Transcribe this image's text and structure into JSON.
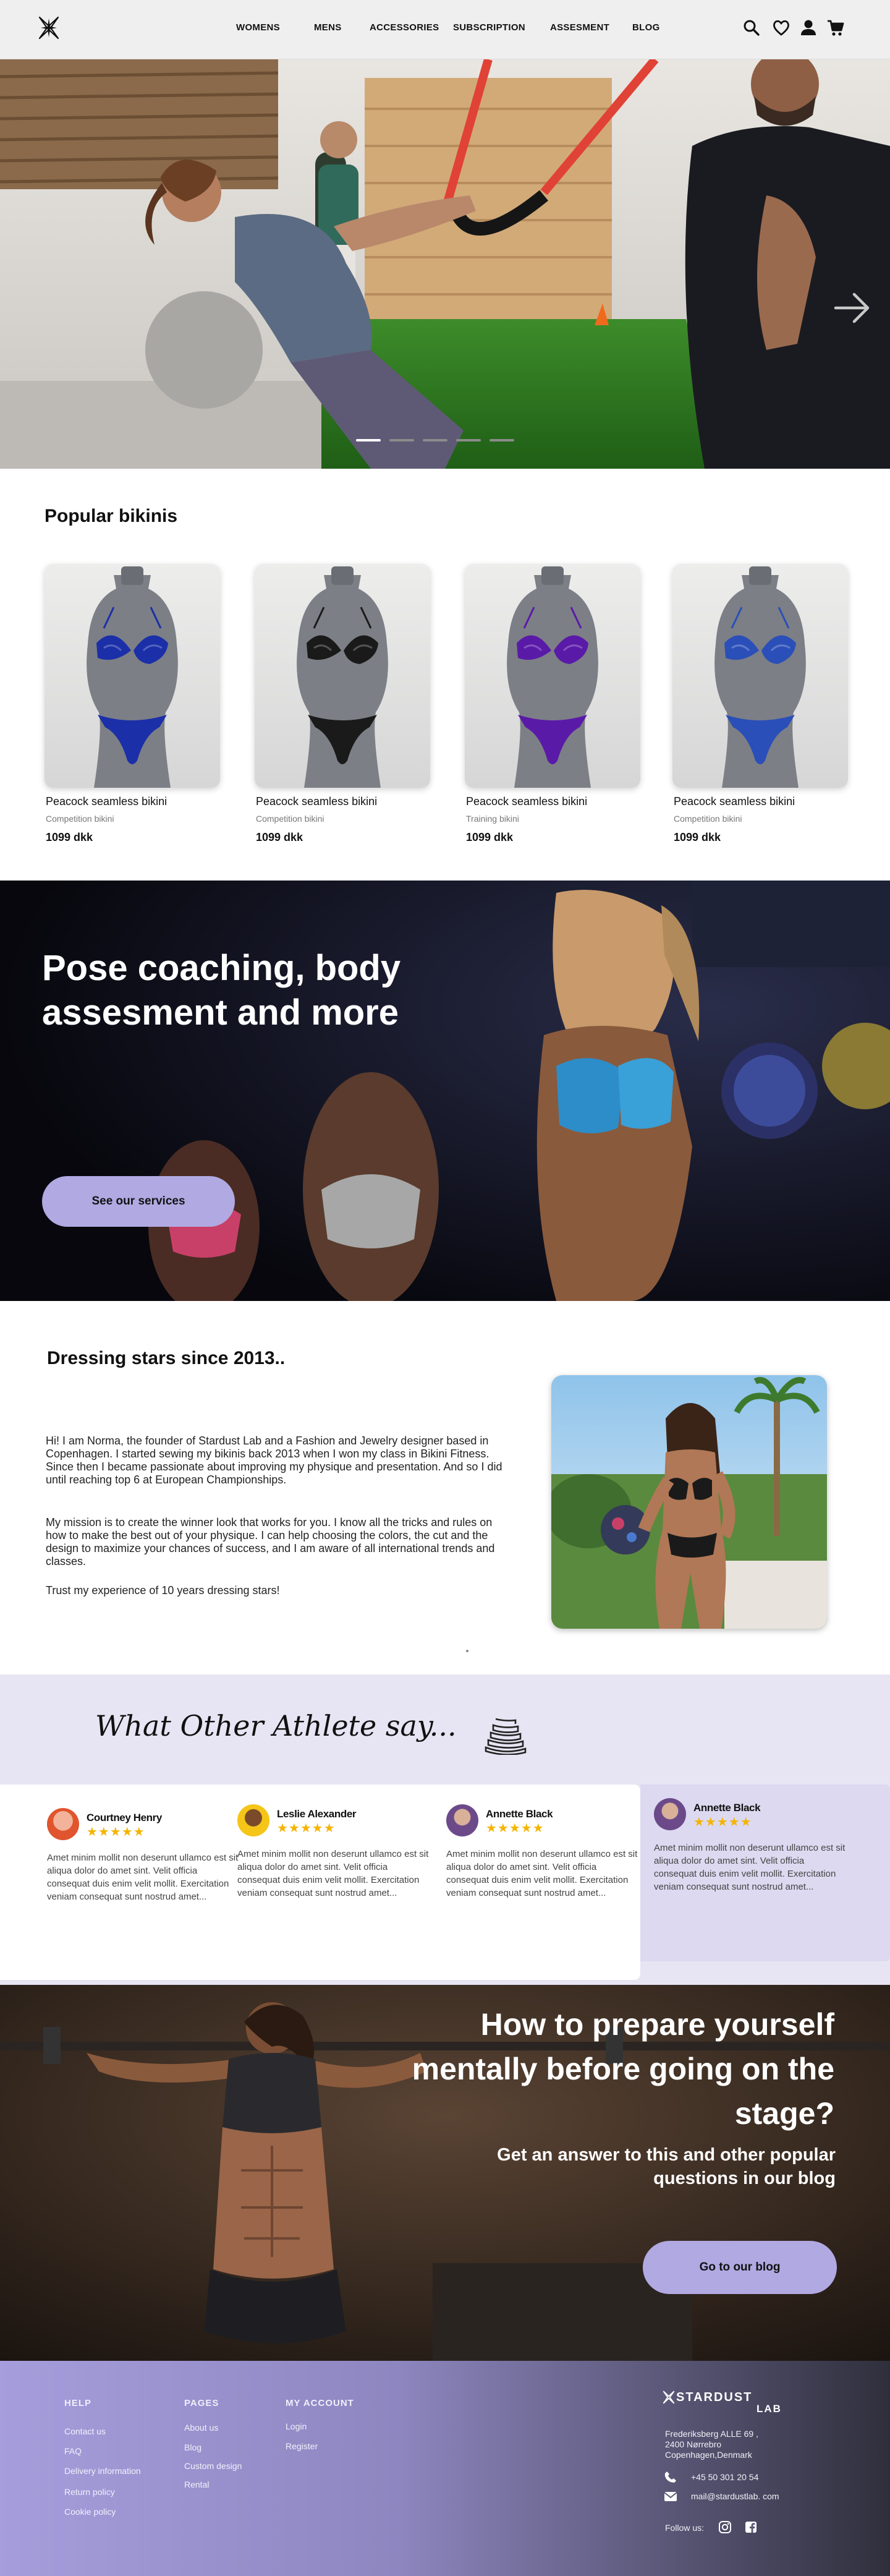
{
  "colors": {
    "accent": "#b1a9e2",
    "testimonial_bg": "#e7e5f3",
    "star": "#f4b400",
    "header_bg": "#efeff0"
  },
  "header": {
    "nav": [
      "WOMENS",
      "MENS",
      "ACCESSORIES",
      "SUBSCRIPTION",
      "ASSESMENT",
      "BLOG"
    ],
    "icons": [
      "search-icon",
      "heart-icon",
      "user-icon",
      "cart-icon"
    ]
  },
  "hero": {
    "slides": 5,
    "active_slide": 1
  },
  "popular": {
    "title": "Popular bikinis",
    "products": [
      {
        "name": "Peacock seamless bikini",
        "category": "Competition bikini",
        "price": "1099 dkk",
        "color": "#1b2fa8"
      },
      {
        "name": "Peacock seamless bikini",
        "category": "Competition bikini",
        "price": "1099 dkk",
        "color": "#1a1a1a"
      },
      {
        "name": "Peacock seamless bikini",
        "category": "Training bikini",
        "price": "1099 dkk",
        "color": "#5a1aa8"
      },
      {
        "name": "Peacock seamless bikini",
        "category": "Competition bikini",
        "price": "1099 dkk",
        "color": "#2b4fb8"
      }
    ]
  },
  "coaching": {
    "title": "Pose coaching, body assesment and more",
    "button": "See our services"
  },
  "about": {
    "title": "Dressing stars since 2013..",
    "p1": "Hi! I am Norma, the founder of Stardust Lab and a Fashion and Jewelry designer based in Copenhagen. I started sewing my bikinis back 2013 when I won my class in Bikini Fitness. Since then I became passionate about improving my physique and presentation. And so I did until reaching top 6 at European Championships.",
    "p2": "My mission is to create the winner look  that works for you. I know all the tricks and rules on how to make the best out of your physique. I can help choosing the colors, the cut and the design to maximize your chances of success, and I am aware of all international trends and classes.",
    "p3": "Trust my experience of 10 years dressing stars!"
  },
  "testimonials": {
    "title": "What Other Athlete say...",
    "reviews": [
      {
        "name": "Courtney Henry",
        "stars": "★★★★★",
        "rating": 5,
        "text": "Amet minim mollit non deserunt ullamco est sit aliqua dolor do amet sint. Velit officia consequat duis enim velit mollit. Exercitation veniam consequat sunt nostrud amet..."
      },
      {
        "name": "Leslie Alexander",
        "stars": "★★★★★",
        "rating": 5,
        "text": "Amet minim mollit non deserunt ullamco est sit aliqua dolor do amet sint. Velit officia consequat duis enim velit mollit. Exercitation veniam consequat sunt nostrud amet..."
      },
      {
        "name": "Annette Black",
        "stars": "★★★★★",
        "rating": 5,
        "text": "Amet minim mollit non deserunt ullamco est sit aliqua dolor do amet sint. Velit officia consequat duis enim velit mollit. Exercitation veniam consequat sunt nostrud amet..."
      },
      {
        "name": "Annette Black",
        "stars": "★★★★★",
        "rating": 5,
        "text": "Amet minim mollit non deserunt ullamco est sit aliqua dolor do amet sint. Velit officia consequat duis enim velit mollit. Exercitation veniam consequat sunt nostrud amet..."
      }
    ]
  },
  "blog": {
    "title": "How to prepare yourself mentally before going on the stage?",
    "subtitle": "Get an answer to this and other popular questions in our blog",
    "button": "Go to our blog"
  },
  "footer": {
    "help": {
      "heading": "HELP",
      "links": [
        "Contact us",
        "FAQ",
        "Delivery information",
        "Return policy",
        "Cookie policy"
      ]
    },
    "pages": {
      "heading": "PAGES",
      "links": [
        "About us",
        "Blog",
        "Custom design",
        "Rental"
      ]
    },
    "account": {
      "heading": "MY ACCOUNT",
      "links": [
        "Login",
        "Register"
      ]
    },
    "brand": "STARDUST",
    "brand_sub": "LAB",
    "address": [
      "Frederiksberg ALLE 69 ,",
      "2400 Nørrebro",
      "Copenhagen,Denmark"
    ],
    "phone": "+45 50 301 20 54",
    "email": "mail@stardustlab. com",
    "follow": "Follow us:"
  }
}
